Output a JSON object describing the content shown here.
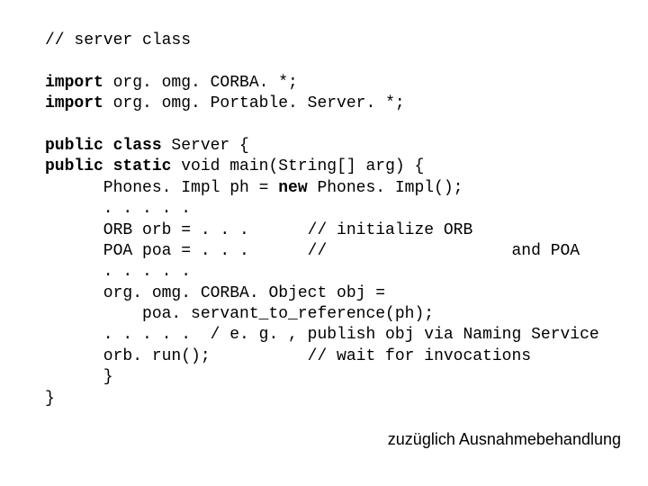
{
  "code": {
    "l01": "// server class",
    "l02": "",
    "l03a": "import",
    "l03b": " org. omg. CORBA. *;",
    "l04a": "import",
    "l04b": " org. omg. Portable. Server. *;",
    "l05": "",
    "l06a": "public class",
    "l06b": " Server {",
    "l07a": "public static",
    "l07b": " void main(String[] arg) {",
    "l08a": "      Phones. Impl ph = ",
    "l08kw": "new",
    "l08b": " Phones. Impl();",
    "l09": "      . . . . .",
    "l10": "      ORB orb = . . .      // initialize ORB",
    "l11": "      POA poa = . . .      //                   and POA",
    "l12": "      . . . . .",
    "l13": "      org. omg. CORBA. Object obj =",
    "l14": "          poa. servant_to_reference(ph);",
    "l15": "      . . . . .  / e. g. , publish obj via Naming Service",
    "l16": "      orb. run();          // wait for invocations",
    "l17": "      }",
    "l18": "}"
  },
  "footer": "zuzüglich Ausnahmebehandlung"
}
